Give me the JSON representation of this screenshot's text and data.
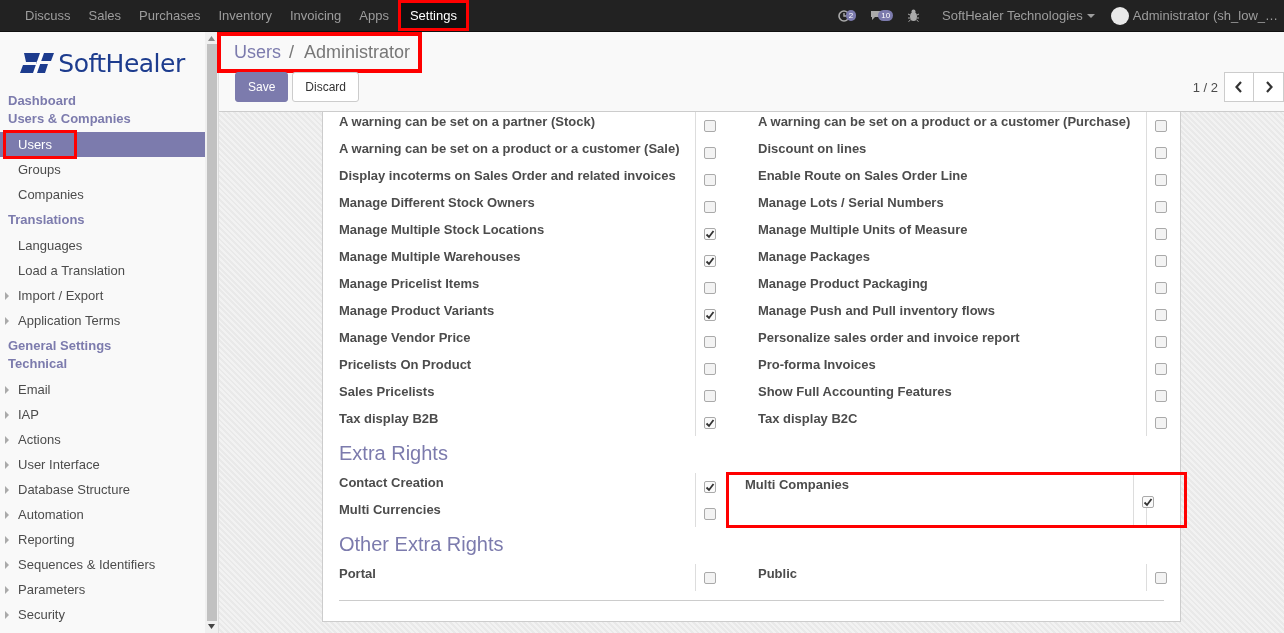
{
  "top_menu": [
    {
      "label": "Discuss",
      "selected": false,
      "highlighted": false
    },
    {
      "label": "Sales",
      "selected": false,
      "highlighted": false
    },
    {
      "label": "Purchases",
      "selected": false,
      "highlighted": false
    },
    {
      "label": "Inventory",
      "selected": false,
      "highlighted": false
    },
    {
      "label": "Invoicing",
      "selected": false,
      "highlighted": false
    },
    {
      "label": "Apps",
      "selected": false,
      "highlighted": false
    },
    {
      "label": "Settings",
      "selected": true,
      "highlighted": true
    }
  ],
  "systray": {
    "activity_count": "2",
    "message_count": "10",
    "company": "SoftHealer Technologies",
    "user": "Administrator (sh_low_…"
  },
  "logo": {
    "text": "SoftHealer"
  },
  "sidebar": {
    "items": [
      {
        "kind": "header",
        "label": "Dashboard"
      },
      {
        "kind": "header",
        "label": "Users & Companies"
      },
      {
        "kind": "item",
        "label": "Users",
        "selected": true,
        "highlighted": true
      },
      {
        "kind": "item",
        "label": "Groups",
        "selected": false,
        "highlighted": false
      },
      {
        "kind": "item",
        "label": "Companies",
        "selected": false,
        "highlighted": false
      },
      {
        "kind": "header",
        "label": "Translations"
      },
      {
        "kind": "item",
        "label": "Languages",
        "selected": false,
        "highlighted": false
      },
      {
        "kind": "item",
        "label": "Load a Translation",
        "selected": false,
        "highlighted": false
      },
      {
        "kind": "folder",
        "label": "Import / Export",
        "selected": false,
        "highlighted": false
      },
      {
        "kind": "folder",
        "label": "Application Terms",
        "selected": false,
        "highlighted": false
      },
      {
        "kind": "header",
        "label": "General Settings"
      },
      {
        "kind": "header",
        "label": "Technical"
      },
      {
        "kind": "folder",
        "label": "Email",
        "selected": false,
        "highlighted": false
      },
      {
        "kind": "folder",
        "label": "IAP",
        "selected": false,
        "highlighted": false
      },
      {
        "kind": "folder",
        "label": "Actions",
        "selected": false,
        "highlighted": false
      },
      {
        "kind": "folder",
        "label": "User Interface",
        "selected": false,
        "highlighted": false
      },
      {
        "kind": "folder",
        "label": "Database Structure",
        "selected": false,
        "highlighted": false
      },
      {
        "kind": "folder",
        "label": "Automation",
        "selected": false,
        "highlighted": false
      },
      {
        "kind": "folder",
        "label": "Reporting",
        "selected": false,
        "highlighted": false
      },
      {
        "kind": "folder",
        "label": "Sequences & Identifiers",
        "selected": false,
        "highlighted": false
      },
      {
        "kind": "folder",
        "label": "Parameters",
        "selected": false,
        "highlighted": false
      },
      {
        "kind": "folder",
        "label": "Security",
        "selected": false,
        "highlighted": false
      }
    ]
  },
  "breadcrumb": {
    "items": [
      "Users",
      "Administrator"
    ],
    "separator": "/",
    "highlighted": true
  },
  "buttons": [
    {
      "kind": "primary",
      "label": "Save"
    },
    {
      "kind": "secondary",
      "label": "Discard"
    }
  ],
  "pager": {
    "text": "1 / 2"
  },
  "sections": [
    {
      "rows": [
        [
          {
            "label": "A warning can be set on a partner (Stock)",
            "checked": false,
            "highlighted": false
          },
          {
            "label": "A warning can be set on a product or a customer (Purchase)",
            "checked": false,
            "highlighted": false
          }
        ],
        [
          {
            "label": "A warning can be set on a product or a customer (Sale)",
            "checked": false,
            "highlighted": false
          },
          {
            "label": "Discount on lines",
            "checked": false,
            "highlighted": false
          }
        ],
        [
          {
            "label": "Display incoterms on Sales Order and related invoices",
            "checked": false,
            "highlighted": false
          },
          {
            "label": "Enable Route on Sales Order Line",
            "checked": false,
            "highlighted": false
          }
        ],
        [
          {
            "label": "Manage Different Stock Owners",
            "checked": false,
            "highlighted": false
          },
          {
            "label": "Manage Lots / Serial Numbers",
            "checked": false,
            "highlighted": false
          }
        ],
        [
          {
            "label": "Manage Multiple Stock Locations",
            "checked": true,
            "highlighted": false
          },
          {
            "label": "Manage Multiple Units of Measure",
            "checked": false,
            "highlighted": false
          }
        ],
        [
          {
            "label": "Manage Multiple Warehouses",
            "checked": true,
            "highlighted": false
          },
          {
            "label": "Manage Packages",
            "checked": false,
            "highlighted": false
          }
        ],
        [
          {
            "label": "Manage Pricelist Items",
            "checked": false,
            "highlighted": false
          },
          {
            "label": "Manage Product Packaging",
            "checked": false,
            "highlighted": false
          }
        ],
        [
          {
            "label": "Manage Product Variants",
            "checked": true,
            "highlighted": false
          },
          {
            "label": "Manage Push and Pull inventory flows",
            "checked": false,
            "highlighted": false
          }
        ],
        [
          {
            "label": "Manage Vendor Price",
            "checked": false,
            "highlighted": false
          },
          {
            "label": "Personalize sales order and invoice report",
            "checked": false,
            "highlighted": false
          }
        ],
        [
          {
            "label": "Pricelists On Product",
            "checked": false,
            "highlighted": false
          },
          {
            "label": "Pro-forma Invoices",
            "checked": false,
            "highlighted": false
          }
        ],
        [
          {
            "label": "Sales Pricelists",
            "checked": false,
            "highlighted": false
          },
          {
            "label": "Show Full Accounting Features",
            "checked": false,
            "highlighted": false
          }
        ],
        [
          {
            "label": "Tax display B2B",
            "checked": true,
            "highlighted": false
          },
          {
            "label": "Tax display B2C",
            "checked": false,
            "highlighted": false
          }
        ]
      ]
    },
    {
      "title": "Extra Rights",
      "rows": [
        [
          {
            "label": "Contact Creation",
            "checked": true,
            "highlighted": false
          },
          {
            "label": "Multi Companies",
            "checked": true,
            "highlighted": true
          }
        ],
        [
          {
            "label": "Multi Currencies",
            "checked": false,
            "highlighted": false
          },
          null
        ]
      ]
    },
    {
      "title": "Other Extra Rights",
      "rows": [
        [
          {
            "label": "Portal",
            "checked": false,
            "highlighted": false
          },
          {
            "label": "Public",
            "checked": false,
            "highlighted": false
          }
        ]
      ]
    }
  ]
}
